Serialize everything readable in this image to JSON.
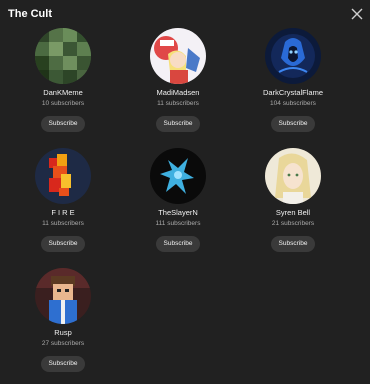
{
  "dialog": {
    "title": "The Cult",
    "close_icon": "close-icon"
  },
  "channels": [
    {
      "name": "DanKMeme",
      "subscribers": "10 subscribers",
      "button": "Subscribe"
    },
    {
      "name": "MadiMadsen",
      "subscribers": "11 subscribers",
      "button": "Subscribe"
    },
    {
      "name": "DarkCrystalFlame",
      "subscribers": "104 subscribers",
      "button": "Subscribe"
    },
    {
      "name": "F I R E",
      "subscribers": "11 subscribers",
      "button": "Subscribe"
    },
    {
      "name": "TheSlayerN",
      "subscribers": "111 subscribers",
      "button": "Subscribe"
    },
    {
      "name": "Syren Bell",
      "subscribers": "21 subscribers",
      "button": "Subscribe"
    },
    {
      "name": "Rusp",
      "subscribers": "27 subscribers",
      "button": "Subscribe"
    }
  ]
}
